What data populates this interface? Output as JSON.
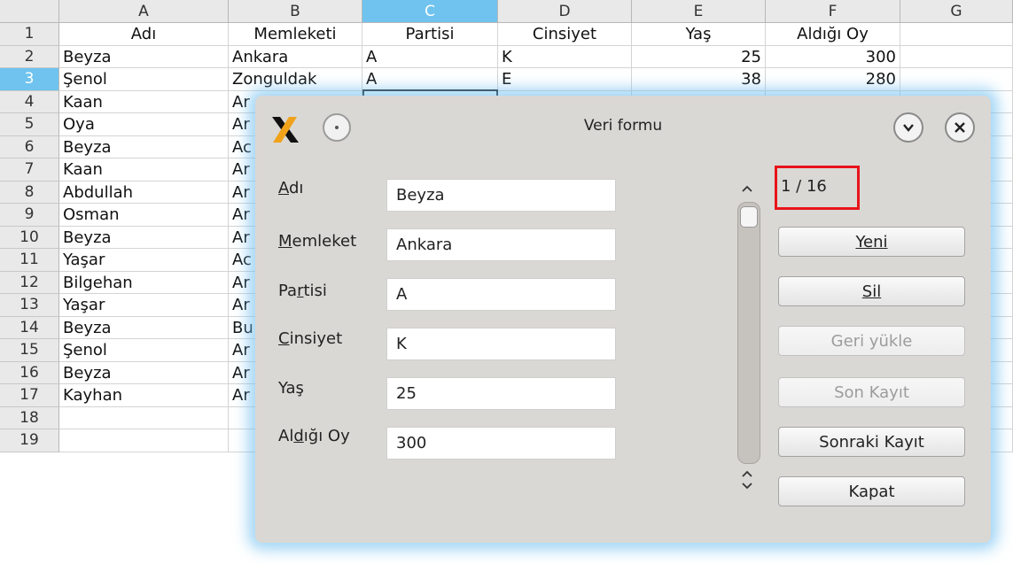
{
  "sheet": {
    "columns": [
      "A",
      "B",
      "C",
      "D",
      "E",
      "F",
      "G"
    ],
    "active_column": "C",
    "active_row": "3",
    "rows": [
      {
        "num": "1",
        "A": "Adı",
        "B": "Memleketi",
        "C": "Partisi",
        "D": "Cinsiyet",
        "E": "Yaş",
        "F": "Aldığı Oy"
      },
      {
        "num": "2",
        "A": "Beyza",
        "B": "Ankara",
        "C": "A",
        "D": "K",
        "E": "25",
        "F": "300"
      },
      {
        "num": "3",
        "A": "Şenol",
        "B": "Zonguldak",
        "C": "A",
        "D": "E",
        "E": "38",
        "F": "280"
      },
      {
        "num": "4",
        "A": "Kaan",
        "B": "Ar"
      },
      {
        "num": "5",
        "A": "Oya",
        "B": "Ar"
      },
      {
        "num": "6",
        "A": "Beyza",
        "B": "Ac"
      },
      {
        "num": "7",
        "A": "Kaan",
        "B": "Ar"
      },
      {
        "num": "8",
        "A": "Abdullah",
        "B": "Ar"
      },
      {
        "num": "9",
        "A": "Osman",
        "B": "Ar"
      },
      {
        "num": "10",
        "A": "Beyza",
        "B": "Ar"
      },
      {
        "num": "11",
        "A": "Yaşar",
        "B": "Ac"
      },
      {
        "num": "12",
        "A": "Bilgehan",
        "B": "Ar"
      },
      {
        "num": "13",
        "A": "Yaşar",
        "B": "Ar"
      },
      {
        "num": "14",
        "A": "Beyza",
        "B": "Bu"
      },
      {
        "num": "15",
        "A": "Şenol",
        "B": "Ar"
      },
      {
        "num": "16",
        "A": "Beyza",
        "B": "Ar"
      },
      {
        "num": "17",
        "A": "Kayhan",
        "B": "Ar"
      },
      {
        "num": "18"
      },
      {
        "num": "19"
      }
    ]
  },
  "dialog": {
    "title": "Veri formu",
    "fields": [
      {
        "label": "Adı",
        "value": "Beyza"
      },
      {
        "label": "Memleket",
        "value": "Ankara"
      },
      {
        "label": "Partisi",
        "value": "A"
      },
      {
        "label": "Cinsiyet",
        "value": "K"
      },
      {
        "label": "Yaş",
        "value": "25"
      },
      {
        "label": "Aldığı Oy",
        "value": "300"
      }
    ],
    "record_counter": "1 / 16",
    "buttons": {
      "new": "Yeni",
      "delete": "Sil",
      "restore": "Geri yükle",
      "prev": "Son Kayıt",
      "next": "Sonraki Kayıt",
      "close": "Kapat"
    }
  },
  "colors": {
    "accent": "#6fc3ee",
    "highlight_box": "#e8141b",
    "dialog_bg": "#dad8d4"
  }
}
